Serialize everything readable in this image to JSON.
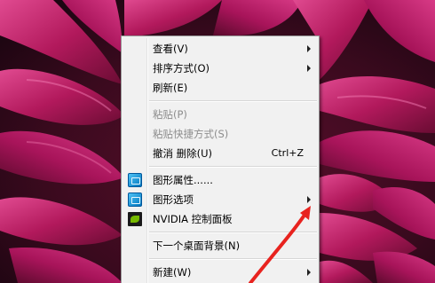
{
  "colors": {
    "menu_background": "#f1f1f1",
    "menu_border": "#979797",
    "disabled_text": "#8d8d8d",
    "annotation_arrow": "#e8231f",
    "wallpaper_petal": "#b2195c"
  },
  "desktop": {
    "wallpaper": "magenta-dahlia-flower"
  },
  "context_menu": {
    "items": [
      {
        "label": "查看(V)",
        "has_submenu": true,
        "enabled": true
      },
      {
        "label": "排序方式(O)",
        "has_submenu": true,
        "enabled": true
      },
      {
        "label": "刷新(E)",
        "has_submenu": false,
        "enabled": true
      },
      {
        "label": "粘贴(P)",
        "has_submenu": false,
        "enabled": false
      },
      {
        "label": "粘贴快捷方式(S)",
        "has_submenu": false,
        "enabled": false
      },
      {
        "label": "撤消 删除(U)",
        "shortcut": "Ctrl+Z",
        "has_submenu": false,
        "enabled": true
      },
      {
        "label": "图形属性......",
        "icon": "intel-graphics-icon",
        "has_submenu": false,
        "enabled": true
      },
      {
        "label": "图形选项",
        "icon": "intel-graphics-icon",
        "has_submenu": true,
        "enabled": true
      },
      {
        "label": "NVIDIA 控制面板",
        "icon": "nvidia-icon",
        "has_submenu": false,
        "enabled": true
      },
      {
        "label": "下一个桌面背景(N)",
        "has_submenu": false,
        "enabled": true
      },
      {
        "label": "新建(W)",
        "has_submenu": true,
        "enabled": true
      }
    ]
  }
}
